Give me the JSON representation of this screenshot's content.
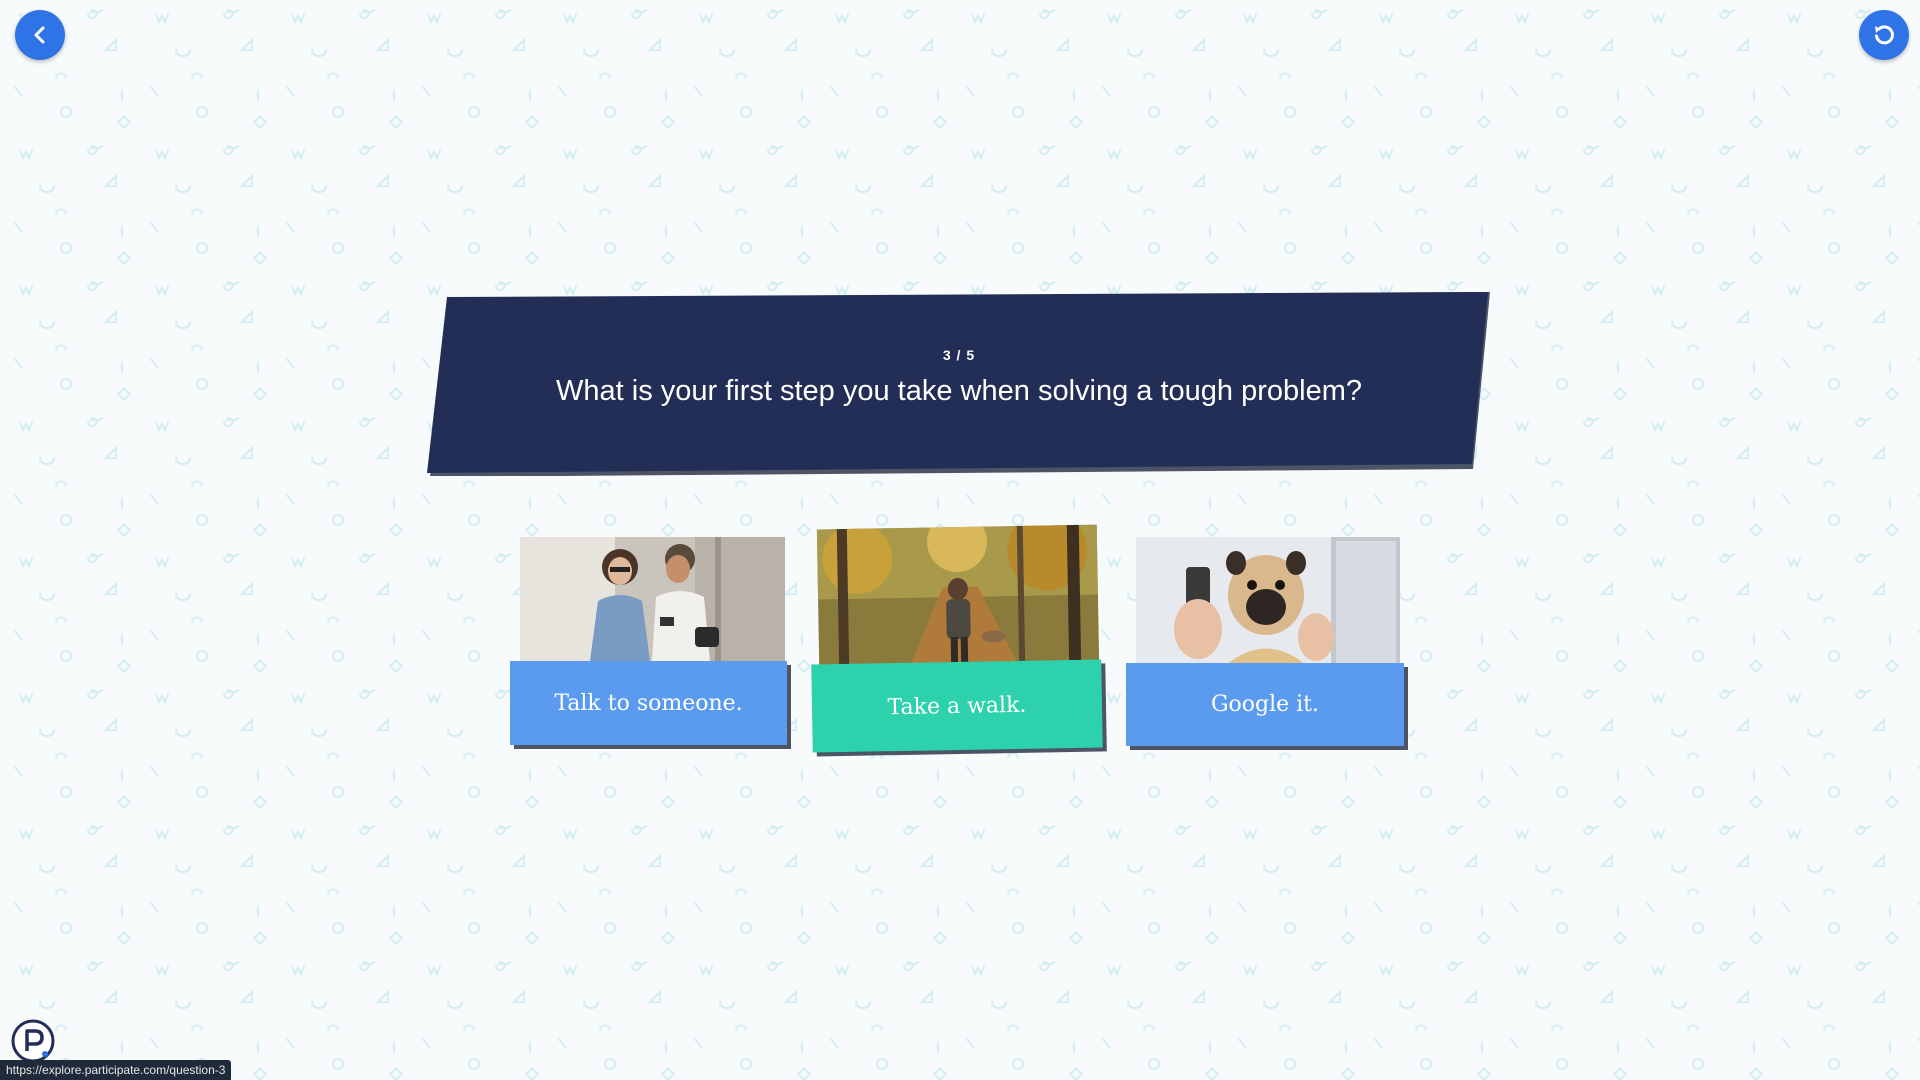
{
  "page": {
    "background_color": "#f8fbfc",
    "pattern_color": "#d4edf0"
  },
  "nav": {
    "back_icon": "chevron-left-icon",
    "restart_icon": "restart-icon",
    "button_color": "#2f74e6"
  },
  "question": {
    "counter": "3 / 5",
    "title": "What is your first step you take when solving a tough problem?",
    "card_color": "#232e56",
    "shadow_color": "#4c5466"
  },
  "answers": [
    {
      "label": "Talk to someone.",
      "photo": "two-people-looking-at-phone",
      "color": "#5a9bef"
    },
    {
      "label": "Take a walk.",
      "photo": "person-walking-dog-autumn-forest",
      "color": "#2dd1ab"
    },
    {
      "label": "Google it.",
      "photo": "pug-holding-phone",
      "color": "#5a9bef"
    }
  ],
  "footer": {
    "logo_icon": "participate-logo-icon",
    "status_url": "https://explore.participate.com/question-3"
  }
}
